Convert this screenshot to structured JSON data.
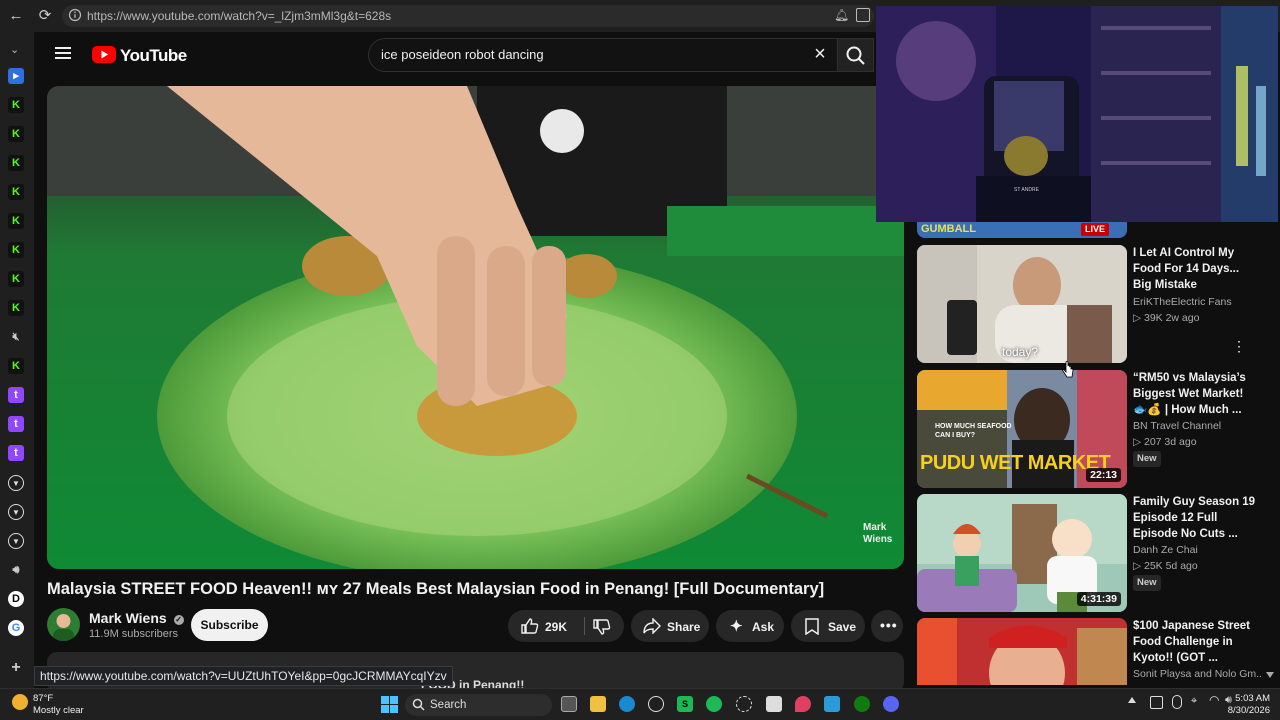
{
  "browser": {
    "url": "https://www.youtube.com/watch?v=_lZjm3mMl3g&t=628s",
    "status_url": "https://www.youtube.com/watch?v=UUZtUhTOYeI&pp=0gcJCRMMAYcqIYzv"
  },
  "youtube": {
    "logo_text": "YouTube",
    "search_query": "ice poseideon robot dancing"
  },
  "video": {
    "title": "Malaysia STREET FOOD Heaven!! ᴍʏ 27 Meals Best Malaysian Food in Penang! [Full Documentary]",
    "watermark": "Mark\nWiens",
    "description_peek": "FOOD in Penang!!"
  },
  "channel": {
    "name": "Mark Wiens",
    "subscribers": "11.9M subscribers",
    "subscribe_label": "Subscribe"
  },
  "actions": {
    "likes": "29K",
    "share_label": "Share",
    "ask_label": "Ask",
    "save_label": "Save"
  },
  "recommendations": {
    "top_live_badge": "LIVE",
    "top_live_thumb_text": "GUMBALL",
    "items": [
      {
        "title": "I Let AI Control My Food For 14 Days... Big Mistake",
        "channel": "EriKTheElectric Fans",
        "meta": "▷ 39K  2w ago",
        "duration": "",
        "is_new": false,
        "thumb_caption": "today?"
      },
      {
        "title": "“RM50 vs Malaysia’s Biggest Wet Market! 🐟💰 | How Much ...",
        "channel": "BN Travel Channel",
        "meta": "▷ 207  3d ago",
        "duration": "22:13",
        "is_new": true,
        "thumb_caption": "PUDU WET MARKET",
        "thumb_subcaption": "HOW MUCH SEAFOOD CAN I BUY?"
      },
      {
        "title": "Family Guy Season 19 Episode 12 Full Episode No Cuts ...",
        "channel": "Danh Ze Chai",
        "meta": "▷ 25K  5d ago",
        "duration": "4:31:39",
        "is_new": true
      },
      {
        "title": "$100 Japanese Street Food Challenge in Kyoto!! (GOT ...",
        "channel": "Sonit Playsa and Nolo Gm...",
        "meta": "",
        "duration": "",
        "is_new": false
      }
    ],
    "new_label": "New"
  },
  "taskbar": {
    "temperature": "87°F",
    "condition": "Mostly clear",
    "search_label": "Search",
    "time": "5:03 AM",
    "date": "8/30/2026"
  },
  "colors": {
    "yt_red": "#ff0000",
    "background": "#0f0f0f",
    "spotify_green": "#1db954"
  }
}
